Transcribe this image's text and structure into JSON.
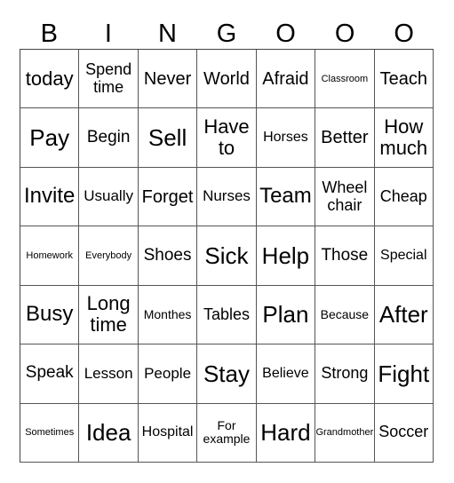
{
  "header": [
    "B",
    "I",
    "N",
    "G",
    "O",
    "O",
    "O"
  ],
  "cells": [
    [
      "today",
      "Spend time",
      "Never",
      "World",
      "Afraid",
      "Classroom",
      "Teach"
    ],
    [
      "Pay",
      "Begin",
      "Sell",
      "Have to",
      "Horses",
      "Better",
      "How much"
    ],
    [
      "Invite",
      "Usually",
      "Forget",
      "Nurses",
      "Team",
      "Wheel chair",
      "Cheap"
    ],
    [
      "Homework",
      "Everybody",
      "Shoes",
      "Sick",
      "Help",
      "Those",
      "Special"
    ],
    [
      "Busy",
      "Long time",
      "Monthes",
      "Tables",
      "Plan",
      "Because",
      "After"
    ],
    [
      "Speak",
      "Lesson",
      "People",
      "Stay",
      "Believe",
      "Strong",
      "Fight"
    ],
    [
      "Sometimes",
      "Idea",
      "Hospital",
      "For example",
      "Hard",
      "Grandmother",
      "Soccer"
    ]
  ]
}
